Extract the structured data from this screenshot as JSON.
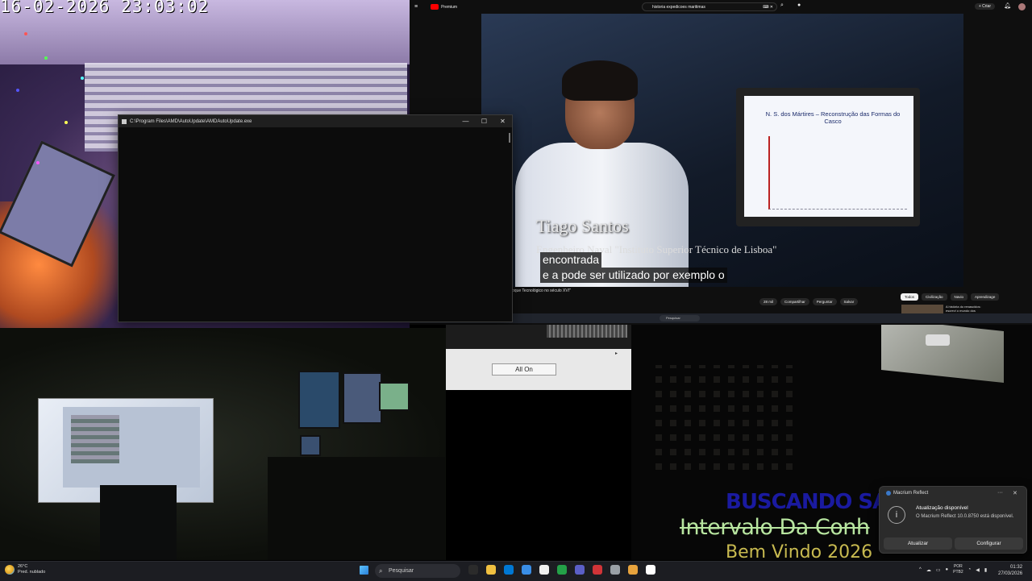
{
  "camera": {
    "timestamp": "16-02-2026  23:03:02"
  },
  "cmd_window": {
    "title": "C:\\Program Files\\AMD\\AutoUpdate\\AMDAutoUpdate.exe",
    "minimize_glyph": "—",
    "maximize_glyph": "☐",
    "close_glyph": "✕"
  },
  "youtube": {
    "brand": "Premium",
    "search_query": "historia expedicoes maritimas",
    "create_label": "+ Criar",
    "video": {
      "slide_title": "N. S. dos Mártires – Reconstrução das Formas do Casco",
      "lower_third_name": "Tiago Santos",
      "lower_third_role": "Engenheiro Naval \"Instituto Superior Técnico de Lisboa\"",
      "subtitles": [
        "encontrada",
        "e a pode ser utilizado por exemplo o"
      ]
    },
    "video_title": "oque Tecnológico no século XVI\"",
    "actions": [
      "28 mil",
      "Compartilhar",
      "Perguntar",
      "Salvar"
    ],
    "chips": [
      "Todos",
      "Civilização",
      "Navio",
      "Aprendizage"
    ],
    "recommendation_text": "A história do renascidos: escrevi o mundo dos",
    "bar_search_placeholder": "Pesquisar"
  },
  "middle_panel": {
    "button_label": "All On",
    "scroll_arrow": "▸"
  },
  "overlay_text": {
    "line1": "BUSCANDO SA",
    "line2": "Intervalo Da Conh",
    "line3": "Bem Vindo 2026"
  },
  "toast": {
    "app_name": "Macrium Reflect",
    "more_glyph": "···",
    "close_glyph": "✕",
    "info_glyph": "i",
    "title": "Atualização disponível",
    "body": "O Macrium Reflect 10.0.8750 está disponível.",
    "button_update": "Atualizar",
    "button_configure": "Configurar"
  },
  "taskbar": {
    "weather_temp": "26°C",
    "weather_desc": "Pred. nublado",
    "search_placeholder": "Pesquisar",
    "lang_top": "POR",
    "lang_bottom": "PTB2",
    "time": "01:32",
    "date": "27/03/2026",
    "app_colors": [
      "#2b2b2b",
      "#f0c040",
      "#0078d4",
      "#3a8ee6",
      "#f0f0f0",
      "#24a148",
      "#5b5fc7",
      "#d13438",
      "#9aa0a6",
      "#e8a33d",
      "#ffffff"
    ]
  },
  "colors": {
    "youtube_red": "#ff0000",
    "subtitle_bg": "#080808",
    "toast_bg": "#2b2b2b",
    "taskbar_bg": "#1c1d22"
  }
}
